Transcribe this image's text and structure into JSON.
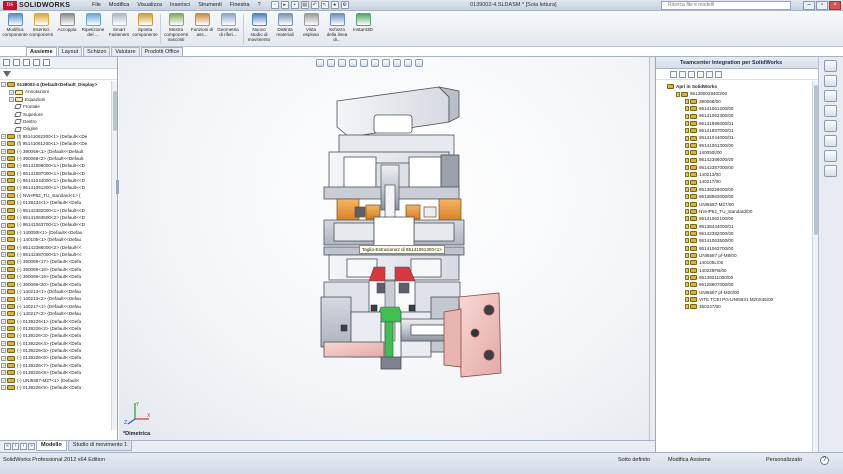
{
  "app": {
    "brand": "SOLIDWORKS",
    "brand_mark": "DS",
    "menu": [
      "File",
      "Modifica",
      "Visualizza",
      "Inserisci",
      "Strumenti",
      "Finestra",
      "?"
    ],
    "document_title": "0139002-4.SLDASM * [Sola lettura]",
    "search_placeholder": "Ricerca file e modelli"
  },
  "ribbon": [
    {
      "label": "Modifica componente",
      "icon": "edit-component-icon",
      "color": "#5b8cc6"
    },
    {
      "label": "Inserisci componenti",
      "icon": "insert-components-icon",
      "color": "#d9a93a"
    },
    {
      "label": "Accoppia",
      "icon": "mate-icon",
      "color": "#8c8c8c"
    },
    {
      "label": "Ripetizione del ...",
      "icon": "pattern-icon",
      "color": "#6aa7d8"
    },
    {
      "label": "Smart Fasteners",
      "icon": "smart-fasteners-icon",
      "color": "#b0b8c4"
    },
    {
      "label": "Sposta componente",
      "icon": "move-component-icon",
      "color": "#c9a037"
    },
    {
      "label": "Mostra componenti nascosti",
      "icon": "show-hidden-icon",
      "color": "#7fae5a"
    },
    {
      "label": "Funzioni di ass...",
      "icon": "assembly-features-icon",
      "color": "#cf8a3b"
    },
    {
      "label": "Geometria di riferi...",
      "icon": "reference-geometry-icon",
      "color": "#8aa6c9"
    },
    {
      "label": "Nuovo studio di movimento",
      "icon": "motion-study-icon",
      "color": "#4f86c6"
    },
    {
      "label": "Distinta materiali",
      "icon": "bom-icon",
      "color": "#7c95b5"
    },
    {
      "label": "Vista esplosa",
      "icon": "exploded-view-icon",
      "color": "#9b9b9b"
    },
    {
      "label": "Schizzo della linea di...",
      "icon": "explode-line-sketch-icon",
      "color": "#6b8fbf"
    },
    {
      "label": "Instant3D",
      "icon": "instant3d-icon",
      "color": "#56a36c"
    }
  ],
  "command_tabs": [
    "Assieme",
    "Layout",
    "Schizzo",
    "Valutare",
    "Prodotti Office"
  ],
  "tree": {
    "root": "0139002-4 (Default<Default_Display>",
    "nodes": [
      {
        "label": "Annotazioni",
        "kind": "ann"
      },
      {
        "label": "Equazioni",
        "kind": "ann"
      },
      {
        "label": "Frontale",
        "kind": "plane"
      },
      {
        "label": "Superiore",
        "kind": "plane"
      },
      {
        "label": "Destro",
        "kind": "plane"
      },
      {
        "label": "Origine",
        "kind": "plane"
      }
    ],
    "parts": [
      "(f) 95141062300<1> (Default<<De",
      "(f) 95141061200<1> (Default<<De",
      "(-) 390068<1> (Default<<Default",
      "(-) 390068<2> (Default<<Default",
      "(-) 95141896000<1> (Default<<D",
      "(-) 95141897000<1> (Default<<D",
      "(-) 95141044000<1> (Default<<D",
      "(-) 95141061300<1> (Default<<D",
      "(-) NVHP82_TU_standard<1> (",
      "(-) 0138434<1> (Default<<Defa",
      "(-) 95142382000<1> (Default<<D",
      "(-) 95141063500<2> (Default<<D",
      "(-) 95141063700<1> (Default<<D",
      "(-) 140050t<1> (Default<<Defau",
      "(-) 140105<1> (Default<<Defau",
      "(-) 95142386000<2> (Default<<",
      "(-) 95142387000<1> (Default<<",
      "(-) 390068<17> (Default<<Defa",
      "(-) 390068<18> (Default<<Defa",
      "(-) 390068<19> (Default<<Defa",
      "(-) 390068<20> (Default<<Defa",
      "(-) 140213<1> (Default<<Defau",
      "(-) 140213<2> (Default<<Defau",
      "(-) 140217<1> (Default<<Defau",
      "(-) 140217<2> (Default<<Defau",
      "(-) 0139226<1> (Default<<Defa",
      "(-) 0139226<2> (Default<<Defa",
      "(-) 0139226<3> (Default<<Defa",
      "(-) 0139226<4> (Default<<Defa",
      "(-) 0139226<5> (Default<<Defa",
      "(-) 0139226<6> (Default<<Defa",
      "(-) 0139226<7> (Default<<Defa",
      "(-) 0139226<8> (Default<<Defa",
      "(-) UNI5587-M27<1> (Default<",
      "(-) 0139226<9> (Default<<Defa"
    ]
  },
  "viewport": {
    "tooltip": "Taglio-Estrusione2 di 95141061300<1>",
    "view_label": "*Dimetrica"
  },
  "teamcenter": {
    "title": "Teamcenter Integration per SolidWorks",
    "root": "Apri in SolidWorks",
    "assembly": "951390029400/00",
    "items": [
      "390068/00",
      "95141061200/00",
      "95141062300/00",
      "95141896000/01",
      "95141897000/01",
      "95141044000/01",
      "95141061300/00",
      "140050t/00",
      "95142386000/00",
      "95142387000/00",
      "140213/00",
      "140217/00",
      "95139226000/00",
      "95138983000/00",
      "UNI5587-M27/00",
      "NVHP82_TU_standard/00",
      "95141062100/00",
      "95138434000/01",
      "95142382000/00",
      "95141063500/00",
      "95141063700/00",
      "UNI5587 pf-M8/00",
      "140105L/00",
      "140228FB/00",
      "95139311000/00",
      "95128607000/00",
      "UNI5587 pf-M20/00",
      "VITE TCEI PG-UNI5931 M20X45/00",
      "350247/00"
    ]
  },
  "bottom_tabs": [
    "Modello",
    "Studio di movimento 1"
  ],
  "status": {
    "left": "SolidWorks Professional 2012 x64 Edition",
    "mid1": "Sotto definito",
    "mid2": "Modifica Assieme",
    "right": "Personalizzato"
  },
  "colors": {
    "body_light": "#e9ecf0",
    "body_mid": "#c5cad2",
    "body_dark": "#59606b",
    "orange": "#e8963c",
    "pink_flange": "#f0c7c4",
    "green_part": "#3fbf4f",
    "red_part": "#d9363e",
    "bolt_dark": "#3a3f46"
  }
}
